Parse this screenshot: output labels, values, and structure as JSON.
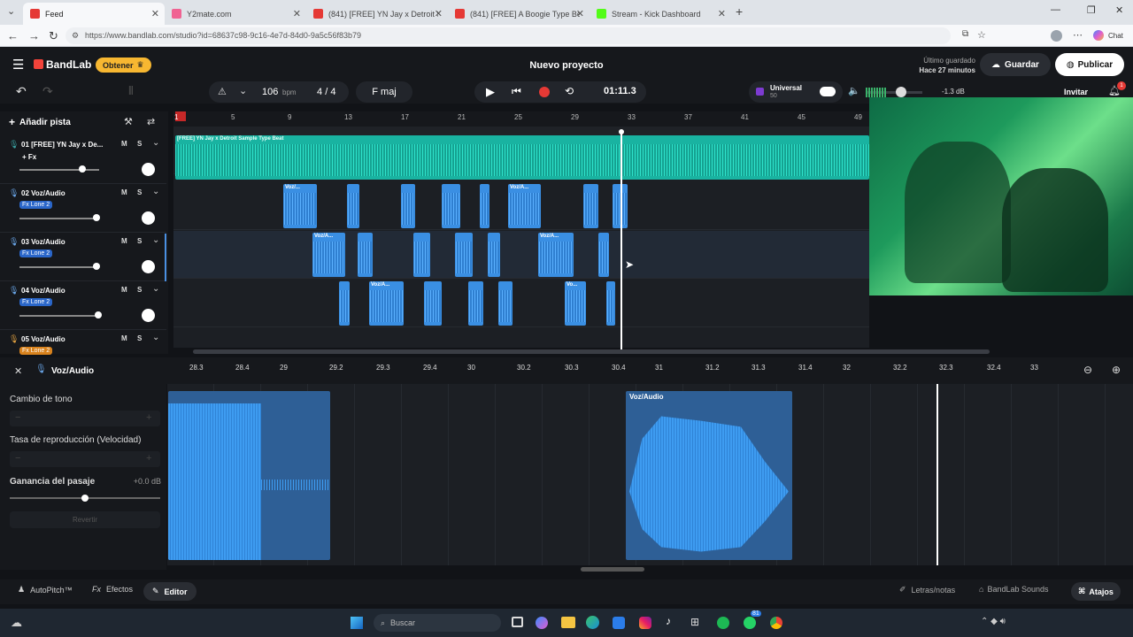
{
  "browser": {
    "tabs": [
      {
        "title": "Feed",
        "color": "#e53935"
      },
      {
        "title": "Y2mate.com",
        "color": "#f06292"
      },
      {
        "title": "(841) [FREE] YN Jay x Detroit Sampl",
        "color": "#e53935"
      },
      {
        "title": "(841) [FREE] A Boogie Type Beat -",
        "color": "#e53935"
      },
      {
        "title": "Stream - Kick Dashboard",
        "color": "#53fc18"
      }
    ],
    "url": "https://www.bandlab.com/studio?id=68637c98-9c16-4e7d-84d0-9a5c56f83b79",
    "chat_label": "Chat"
  },
  "app": {
    "logo": "BandLab",
    "obtain_button": "Obtener",
    "project_title": "Nuevo proyecto",
    "saved_line1": "Último guardado",
    "saved_line2": "Hace 27 minutos",
    "save_button": "Guardar",
    "publish_button": "Publicar",
    "invite_button": "Invitar",
    "notification_count": "1"
  },
  "transport": {
    "bpm_value": "106",
    "bpm_unit": "bpm",
    "time_sig_num": "4",
    "time_sig_sep": "/",
    "time_sig_den": "4",
    "key": "F maj",
    "time": "01:11.3",
    "universal_label": "Universal",
    "universal_sub": "50",
    "volume_db": "-1.3 dB"
  },
  "ruler": [
    "1",
    "5",
    "9",
    "13",
    "17",
    "21",
    "25",
    "29",
    "33",
    "37",
    "41",
    "45",
    "49"
  ],
  "add_track": "Añadir pista",
  "tracks": [
    {
      "name": "01  [FREE] YN Jay x De...",
      "fx": "+ Fx",
      "fx_style": "plain",
      "icon_color": "#3aa0a0"
    },
    {
      "name": "02  Voz/Audio",
      "fx": "Fx Lone 2",
      "fx_style": "blue",
      "icon_color": "#6aa6e8"
    },
    {
      "name": "03  Voz/Audio",
      "fx": "Fx Lone 2",
      "fx_style": "blue",
      "icon_color": "#6aa6e8"
    },
    {
      "name": "04  Voz/Audio",
      "fx": "Fx Lone 2",
      "fx_style": "blue",
      "icon_color": "#6aa6e8"
    },
    {
      "name": "05  Voz/Audio",
      "fx": "Fx Lone 2",
      "fx_style": "orange",
      "icon_color": "#e0a040"
    }
  ],
  "mute_label": "M",
  "solo_label": "S",
  "beat_clip_title": "[FREE] YN Jay x Detroit Sample Type Beat",
  "clip_labels": {
    "a": "Voz/...",
    "b": "Voz/A...",
    "c": "Vo..."
  },
  "editor": {
    "title": "Voz/Audio",
    "ruler": [
      "28.3",
      "28.4",
      "29",
      "29.2",
      "29.3",
      "29.4",
      "30",
      "30.2",
      "30.3",
      "30.4",
      "31",
      "31.2",
      "31.3",
      "31.4",
      "32",
      "32.2",
      "32.3",
      "32.4",
      "33"
    ],
    "pitch_label": "Cambio de tono",
    "rate_label": "Tasa de reproducción (Velocidad)",
    "gain_label": "Ganancia del pasaje",
    "gain_value": "+0.0 dB",
    "revert_button": "Revertir",
    "clip_label": "Voz/Audio"
  },
  "footer": {
    "autopitch": "AutoPitch™",
    "effects": "Efectos",
    "editor": "Editor",
    "lyrics": "Letras/notas",
    "sounds": "BandLab Sounds",
    "shortcuts": "Atajos"
  },
  "taskbar": {
    "search_placeholder": "Buscar",
    "badge": "81"
  }
}
